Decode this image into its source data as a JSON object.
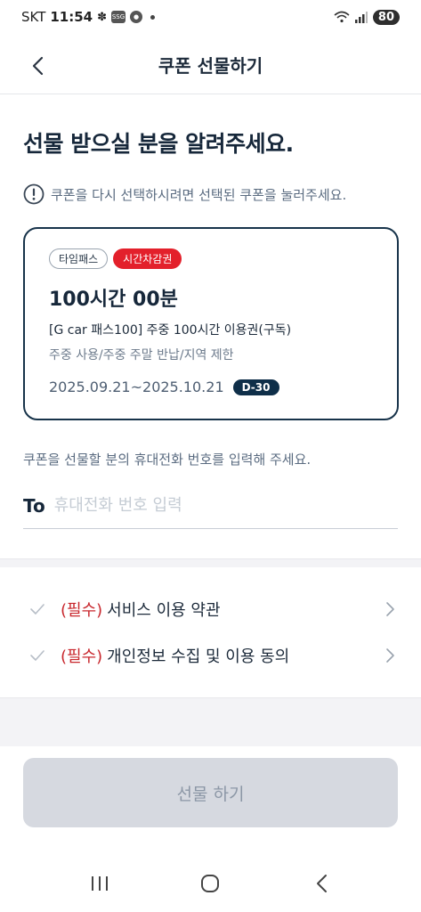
{
  "status_bar": {
    "carrier": "SKT",
    "time": "11:54",
    "icons": [
      "flower-icon",
      "ssg-icon",
      "app-icon",
      "dot-icon"
    ],
    "battery": "80"
  },
  "header": {
    "title": "쿠폰 선물하기"
  },
  "main": {
    "title": "선물 받으실 분을 알려주세요.",
    "notice": "쿠폰을 다시 선택하시려면 선택된 쿠폰을 눌러주세요."
  },
  "coupon": {
    "tags": [
      "타임패스",
      "시간차감권"
    ],
    "title": "100시간 00분",
    "name": "[G car 패스100] 주중 100시간 이용권(구독)",
    "description": "주중 사용/주중 주말 반납/지역 제한",
    "period": "2025.09.21~2025.10.21",
    "dday": "D-30",
    "colors": {
      "border": "#17334a",
      "red_tag": "#e3202b",
      "dday_bg": "#0f2f49"
    }
  },
  "phone": {
    "guide": "쿠폰을 선물할 분의 휴대전화 번호를 입력해 주세요.",
    "to_label": "To",
    "placeholder": "휴대전화 번호 입력",
    "value": ""
  },
  "terms": [
    {
      "required": "(필수)",
      "label": "서비스 이용 약관"
    },
    {
      "required": "(필수)",
      "label": "개인정보 수집 및 이용 동의"
    }
  ],
  "submit": {
    "label": "선물 하기"
  }
}
